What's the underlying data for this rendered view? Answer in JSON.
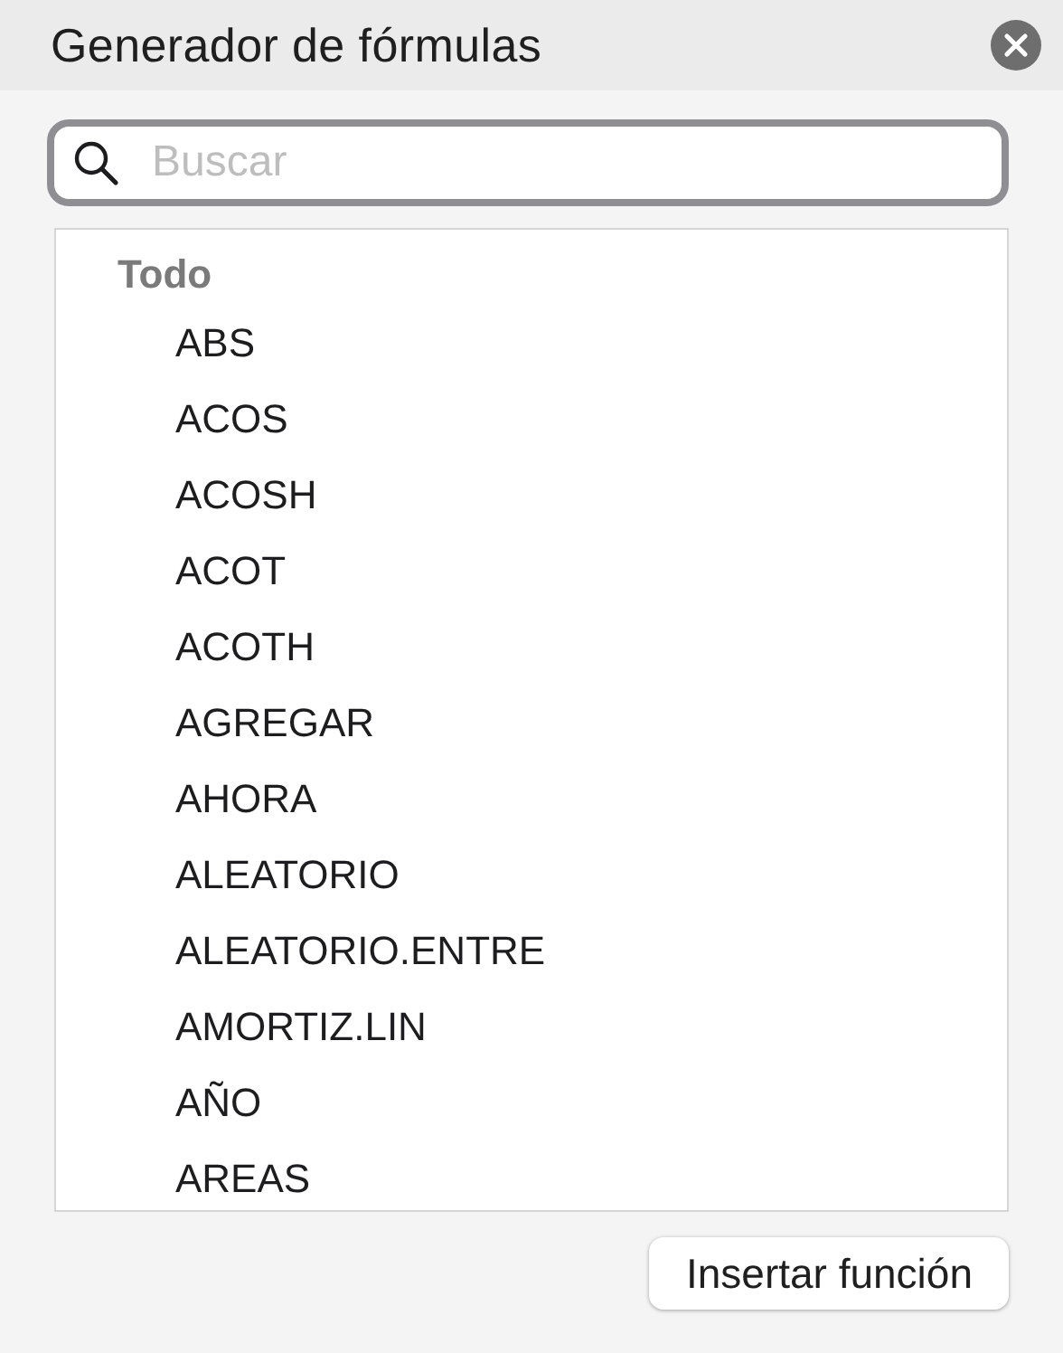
{
  "window": {
    "title": "Generador de fórmulas"
  },
  "search": {
    "placeholder": "Buscar"
  },
  "list": {
    "category": "Todo",
    "items": [
      {
        "label": "ABS"
      },
      {
        "label": "ACOS"
      },
      {
        "label": "ACOSH"
      },
      {
        "label": "ACOT"
      },
      {
        "label": "ACOTH"
      },
      {
        "label": "AGREGAR"
      },
      {
        "label": "AHORA"
      },
      {
        "label": "ALEATORIO"
      },
      {
        "label": "ALEATORIO.ENTRE"
      },
      {
        "label": "AMORTIZ.LIN"
      },
      {
        "label": "AÑO"
      },
      {
        "label": "AREAS"
      }
    ]
  },
  "buttons": [
    "Insertar función"
  ]
}
